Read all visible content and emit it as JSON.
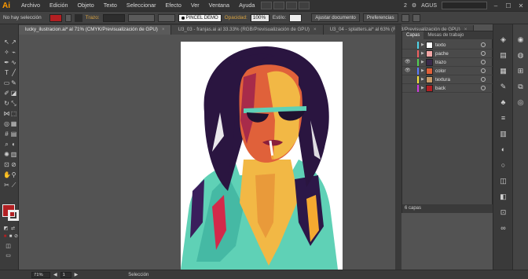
{
  "app": {
    "logo": "Ai"
  },
  "menu": {
    "items": [
      "Archivo",
      "Edición",
      "Objeto",
      "Texto",
      "Seleccionar",
      "Efecto",
      "Ver",
      "Ventana",
      "Ayuda"
    ],
    "user": "AGUS",
    "counter": "2",
    "window_controls": [
      "–",
      "☐",
      "✕"
    ]
  },
  "controlbar": {
    "selection": "No hay selección",
    "stroke_label": "Trazo:",
    "brush": "PINCEL DEMO",
    "opacity_label": "Opacidad:",
    "opacity": "100%",
    "style_label": "Estilo:",
    "doc_settings": "Ajustar documento",
    "preferences": "Preferencias"
  },
  "tabs": [
    {
      "label": "lucky_ilustracion.ai* al 71% (CMYK/Previsualización de GPU)",
      "active": true
    },
    {
      "label": "U3_03 - franjas.ai al 33.33% (RGB/Previsualización de GPU)",
      "active": false
    },
    {
      "label": "U3_04 - splatters.ai* al 63% (RGB/Previsualización de GPU)",
      "active": false
    }
  ],
  "layers_panel": {
    "tabs": [
      "Capas",
      "Mesas de trabajo"
    ],
    "layers": [
      {
        "name": "texto",
        "color": "#4fd4e8",
        "visible": false
      },
      {
        "name": "pache",
        "color": "#f06060",
        "visible": false
      },
      {
        "name": "trazo",
        "color": "#52d152",
        "visible": true
      },
      {
        "name": "color",
        "color": "#5a7bff",
        "visible": true
      },
      {
        "name": "textura",
        "color": "#f4e23a",
        "visible": false
      },
      {
        "name": "back",
        "color": "#d03ae0",
        "visible": false
      }
    ],
    "footer": "6 capas"
  },
  "statusbar": {
    "zoom": "71%",
    "page": "1",
    "mode": "Selección"
  },
  "colors": {
    "fill": "#b21f22",
    "accent": "#ff9a00"
  }
}
